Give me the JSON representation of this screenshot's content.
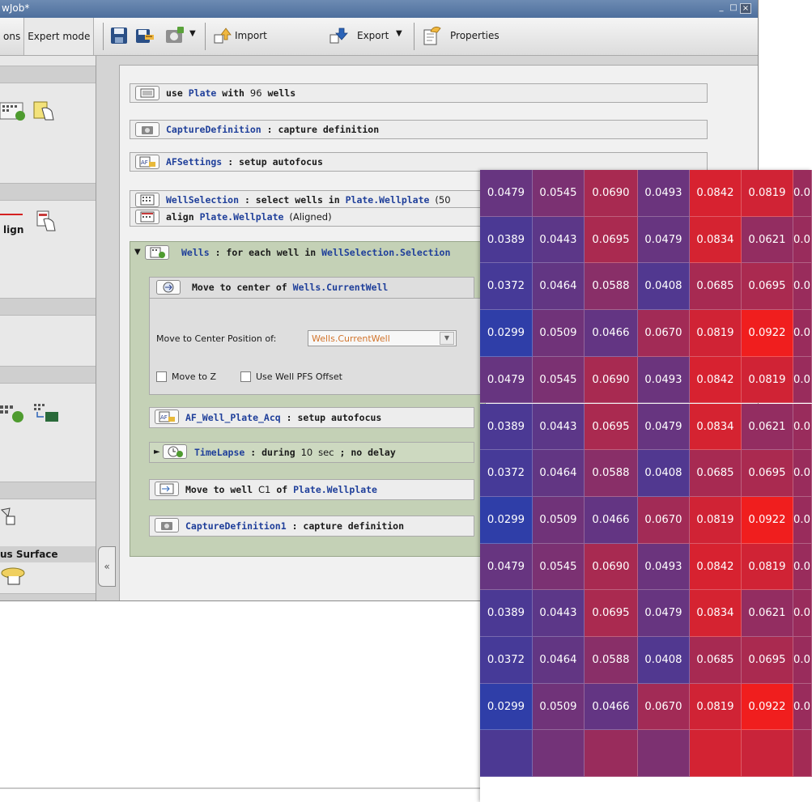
{
  "window": {
    "title": "wJob*",
    "controls": {
      "minimize": "_",
      "maximize": "□",
      "close": "×"
    }
  },
  "toolbar": {
    "mode_tabs": [
      "ons",
      "Expert mode"
    ],
    "import_label": "Import",
    "export_label": "Export",
    "properties_label": "Properties",
    "dropdown_glyph": "▼",
    "icons": [
      "save-icon",
      "save-as-icon",
      "capture-settings-icon",
      "import-icon",
      "export-icon",
      "properties-icon"
    ]
  },
  "palette": {
    "align_label": "lign",
    "surface_header": "us Surface"
  },
  "collapse_glyph": "«",
  "steps": [
    {
      "kw1": "use",
      "name": "Plate",
      "mid": "with",
      "num": "96",
      "tail": "wells"
    },
    {
      "name": "CaptureDefinition",
      "rest": ": capture definition"
    },
    {
      "name": "AFSettings",
      "rest": ": setup autofocus"
    },
    {
      "name": "WellSelection",
      "rest": ": select wells in",
      "name2": "Plate.Wellplate",
      "tail": "(50"
    },
    {
      "kw1": "align",
      "name": "Plate.Wellplate",
      "tail": "(Aligned)"
    }
  ],
  "loop": {
    "name": "Wells",
    "rest": ": for each well in",
    "name2": "WellSelection.Selection",
    "move_center": {
      "label": "Move to center of",
      "target": "Wells.CurrentWell"
    },
    "center_field_label": "Move to Center Position of:",
    "center_field_value": "Wells.CurrentWell",
    "move_z_label": "Move to Z",
    "pfs_label": "Use Well PFS Offset",
    "af_step": {
      "name": "AF_Well_Plate_Acq",
      "rest": ": setup autofocus"
    },
    "timelapse": {
      "name": "TimeLapse",
      "rest": ": during",
      "num": "10",
      "unit": "sec",
      "sep": ";",
      "tail": "no delay"
    },
    "move_well": {
      "label": "Move to well",
      "well": "C1",
      "of": "of",
      "target": "Plate.Wellplate"
    },
    "capture": {
      "name": "CaptureDefinition1",
      "rest": ": capture definition"
    }
  },
  "heatmap": {
    "rows": [
      [
        "0.0479",
        "0.0545",
        "0.0690",
        "0.0493",
        "0.0842",
        "0.0819",
        "0.0"
      ],
      [
        "0.0389",
        "0.0443",
        "0.0695",
        "0.0479",
        "0.0834",
        "0.0621",
        "0.0"
      ],
      [
        "0.0372",
        "0.0464",
        "0.0588",
        "0.0408",
        "0.0685",
        "0.0695",
        "0.0"
      ],
      [
        "0.0299",
        "0.0509",
        "0.0466",
        "0.0670",
        "0.0819",
        "0.0922",
        "0.0"
      ],
      [
        "0.0479",
        "0.0545",
        "0.0690",
        "0.0493",
        "0.0842",
        "0.0819",
        "0.0"
      ],
      [
        "0.0389",
        "0.0443",
        "0.0695",
        "0.0479",
        "0.0834",
        "0.0621",
        "0.0"
      ],
      [
        "0.0372",
        "0.0464",
        "0.0588",
        "0.0408",
        "0.0685",
        "0.0695",
        "0.0"
      ],
      [
        "0.0299",
        "0.0509",
        "0.0466",
        "0.0670",
        "0.0819",
        "0.0922",
        "0.0"
      ],
      [
        "0.0479",
        "0.0545",
        "0.0690",
        "0.0493",
        "0.0842",
        "0.0819",
        "0.0"
      ],
      [
        "0.0389",
        "0.0443",
        "0.0695",
        "0.0479",
        "0.0834",
        "0.0621",
        "0.0"
      ],
      [
        "0.0372",
        "0.0464",
        "0.0588",
        "0.0408",
        "0.0685",
        "0.0695",
        "0.0"
      ],
      [
        "0.0299",
        "0.0509",
        "0.0466",
        "0.0670",
        "0.0819",
        "0.0922",
        "0.0"
      ],
      [
        "",
        "",
        "",
        "",
        "",
        "",
        ""
      ]
    ],
    "color_low": "#2f3ea8",
    "color_high": "#f01e1e"
  }
}
